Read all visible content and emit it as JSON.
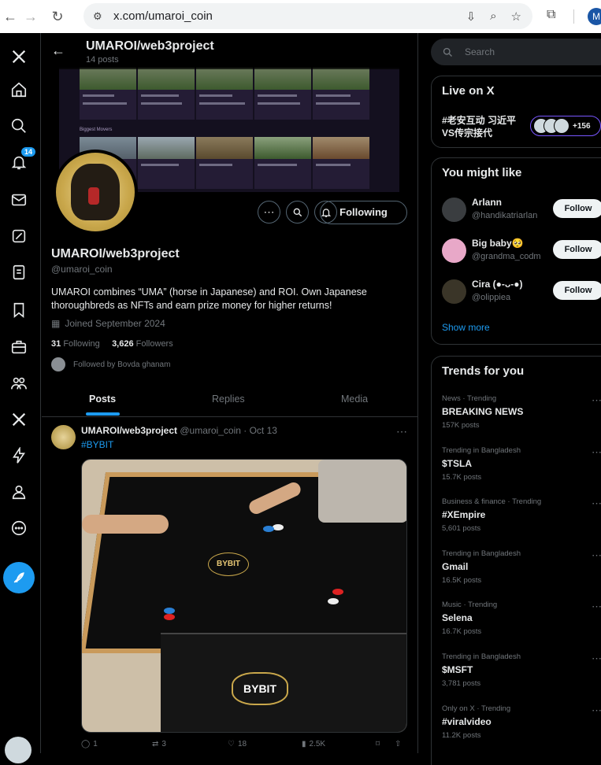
{
  "browser": {
    "url": "x.com/umaroi_coin",
    "profile_initial": "M"
  },
  "nav": {
    "notifications_badge": "14"
  },
  "header": {
    "title": "UMAROI/web3project",
    "post_count": "14 posts"
  },
  "banner": {
    "section_label": "Biggest Movers"
  },
  "profile": {
    "name": "UMAROI/web3project",
    "handle": "@umaroi_coin",
    "bio": "UMAROI combines “UMA” (horse in Japanese) and ROI. Own Japanese thoroughbreds as NFTs and earn prize money for higher returns!",
    "joined": "Joined September 2024",
    "following_count": "31",
    "following_label": "Following",
    "followers_count": "3,626",
    "followers_label": "Followers",
    "followed_by": "Followed by Bovda ghanam",
    "follow_button": "Following"
  },
  "tabs": [
    "Posts",
    "Replies",
    "Media"
  ],
  "tweet": {
    "author": "UMAROI/web3project",
    "handle_time": "@umaroi_coin · Oct 13",
    "hashtag": "#BYBIT",
    "media_logo": "BYBIT",
    "replies": "1",
    "reposts": "3",
    "likes": "18",
    "views": "2.5K"
  },
  "search": {
    "placeholder": "Search"
  },
  "live": {
    "title": "Live on X",
    "text": "#老安互动 习近平VS传宗接代",
    "extra_count": "+156"
  },
  "might_like": {
    "title": "You might like",
    "items": [
      {
        "name": "Arlann",
        "handle": "@handikatriarlan",
        "button": "Follow"
      },
      {
        "name": "Big baby🥺",
        "handle": "@grandma_codm",
        "button": "Follow"
      },
      {
        "name": "Cira (●-ᴗ-●)",
        "handle": "@olippiea",
        "button": "Follow"
      }
    ],
    "show_more": "Show more"
  },
  "trends": {
    "title": "Trends for you",
    "items": [
      {
        "meta": "News · Trending",
        "topic": "BREAKING NEWS",
        "posts": "157K posts"
      },
      {
        "meta": "Trending in Bangladesh",
        "topic": "$TSLA",
        "posts": "15.7K posts"
      },
      {
        "meta": "Business & finance · Trending",
        "topic": "#XEmpire",
        "posts": "5,601 posts"
      },
      {
        "meta": "Trending in Bangladesh",
        "topic": "Gmail",
        "posts": "16.5K posts"
      },
      {
        "meta": "Music · Trending",
        "topic": "Selena",
        "posts": "16.7K posts"
      },
      {
        "meta": "Trending in Bangladesh",
        "topic": "$MSFT",
        "posts": "3,781 posts"
      },
      {
        "meta": "Only on X · Trending",
        "topic": "#viralvideo",
        "posts": "11.2K posts"
      }
    ]
  },
  "colors": {
    "accent": "#1d9bf0",
    "background": "#000000",
    "border": "#2f3336",
    "secondary_text": "#71767b"
  }
}
